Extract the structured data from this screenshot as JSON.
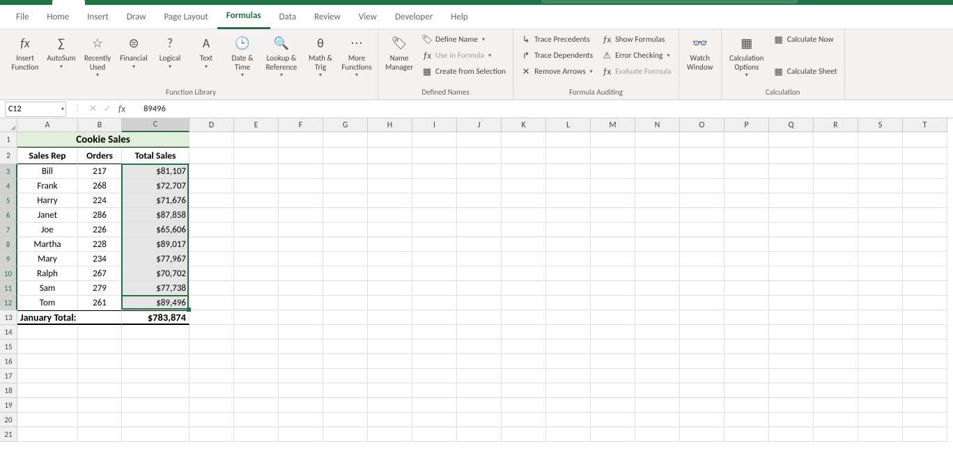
{
  "menu": {
    "file": "File",
    "home": "Home",
    "insert": "Insert",
    "draw": "Draw",
    "page": "Page Layout",
    "formulas": "Formulas",
    "data": "Data",
    "review": "Review",
    "view": "View",
    "developer": "Developer",
    "help": "Help"
  },
  "ribbon": {
    "insertfn": "Insert\nFunction",
    "autosum": "AutoSum",
    "recent": "Recently\nUsed",
    "financial": "Financial",
    "logical": "Logical",
    "text": "Text",
    "datetime": "Date &\nTime",
    "lookup": "Lookup &\nReference",
    "math": "Math &\nTrig",
    "more": "More\nFunctions",
    "group_lib": "Function Library",
    "namemgr": "Name\nManager",
    "define": "Define Name",
    "usein": "Use in Formula",
    "createfrom": "Create from Selection",
    "group_names": "Defined Names",
    "traceprec": "Trace Precedents",
    "tracedep": "Trace Dependents",
    "removear": "Remove Arrows",
    "showformulas": "Show Formulas",
    "errcheck": "Error Checking",
    "evalfx": "Evaluate Formula",
    "group_audit": "Formula Auditing",
    "watch": "Watch\nWindow",
    "calcopt": "Calculation\nOptions",
    "calcnow": "Calculate Now",
    "calcsheet": "Calculate Sheet",
    "group_calc": "Calculation"
  },
  "namebox": "C12",
  "formula": "89496",
  "cols": [
    "A",
    "B",
    "C",
    "D",
    "E",
    "F",
    "G",
    "H",
    "I",
    "J",
    "K",
    "L",
    "M",
    "N",
    "O",
    "P",
    "Q",
    "R",
    "S",
    "T"
  ],
  "colw": {
    "A": 87,
    "B": 63,
    "C": 97,
    "other": 64
  },
  "rowh": {
    "1": 22,
    "2": 24,
    "other": 21
  },
  "sheet": {
    "title": "Cookie Sales",
    "headers": {
      "a": "Sales Rep",
      "b": "Orders",
      "c": "Total Sales"
    },
    "rows": [
      {
        "rep": "Bill",
        "orders": "217",
        "sales": "$81,107"
      },
      {
        "rep": "Frank",
        "orders": "268",
        "sales": "$72,707"
      },
      {
        "rep": "Harry",
        "orders": "224",
        "sales": "$71,676"
      },
      {
        "rep": "Janet",
        "orders": "286",
        "sales": "$87,858"
      },
      {
        "rep": "Joe",
        "orders": "226",
        "sales": "$65,606"
      },
      {
        "rep": "Martha",
        "orders": "228",
        "sales": "$89,017"
      },
      {
        "rep": "Mary",
        "orders": "234",
        "sales": "$77,967"
      },
      {
        "rep": "Ralph",
        "orders": "267",
        "sales": "$70,702"
      },
      {
        "rep": "Sam",
        "orders": "279",
        "sales": "$77,738"
      },
      {
        "rep": "Tom",
        "orders": "261",
        "sales": "$89,496"
      }
    ],
    "total_label": "January Total:",
    "total_value": "$783,874"
  }
}
